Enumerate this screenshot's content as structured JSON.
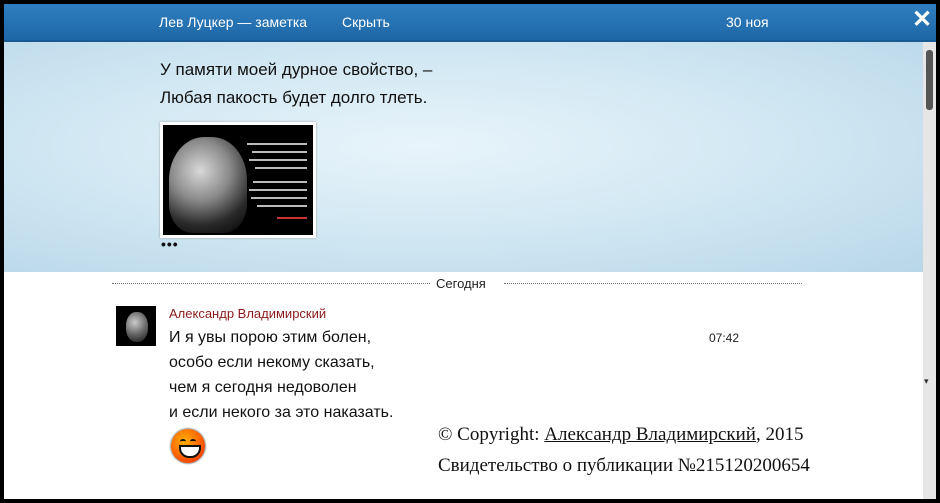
{
  "header": {
    "title": "Лев Луцкер — заметка",
    "hide_label": "Скрыть",
    "date": "30 ноя",
    "close_icon": "close-icon"
  },
  "note": {
    "line1": "У памяти моей дурное свойство, –",
    "line2": "Любая пакость будет долго тлеть.",
    "more": "•••"
  },
  "thread": {
    "separator_label": "Сегодня",
    "message": {
      "author": "Александр Владимирский",
      "time": "07:42",
      "lines": [
        "И я увы порою этим болен,",
        "особо если некому сказать,",
        "чем я сегодня недоволен",
        "и если некого за это наказать."
      ],
      "emoji": "smile-emoji-icon"
    }
  },
  "copyright": {
    "prefix": "© Copyright: ",
    "author_link": "Александр Владимирский",
    "suffix": ", 2015",
    "certificate": "Свидетельство о публикации №215120200654"
  },
  "colors": {
    "header_bg": "#2272b2",
    "author_color": "#8b1a1a",
    "note_bg": "#cfe6f2"
  }
}
